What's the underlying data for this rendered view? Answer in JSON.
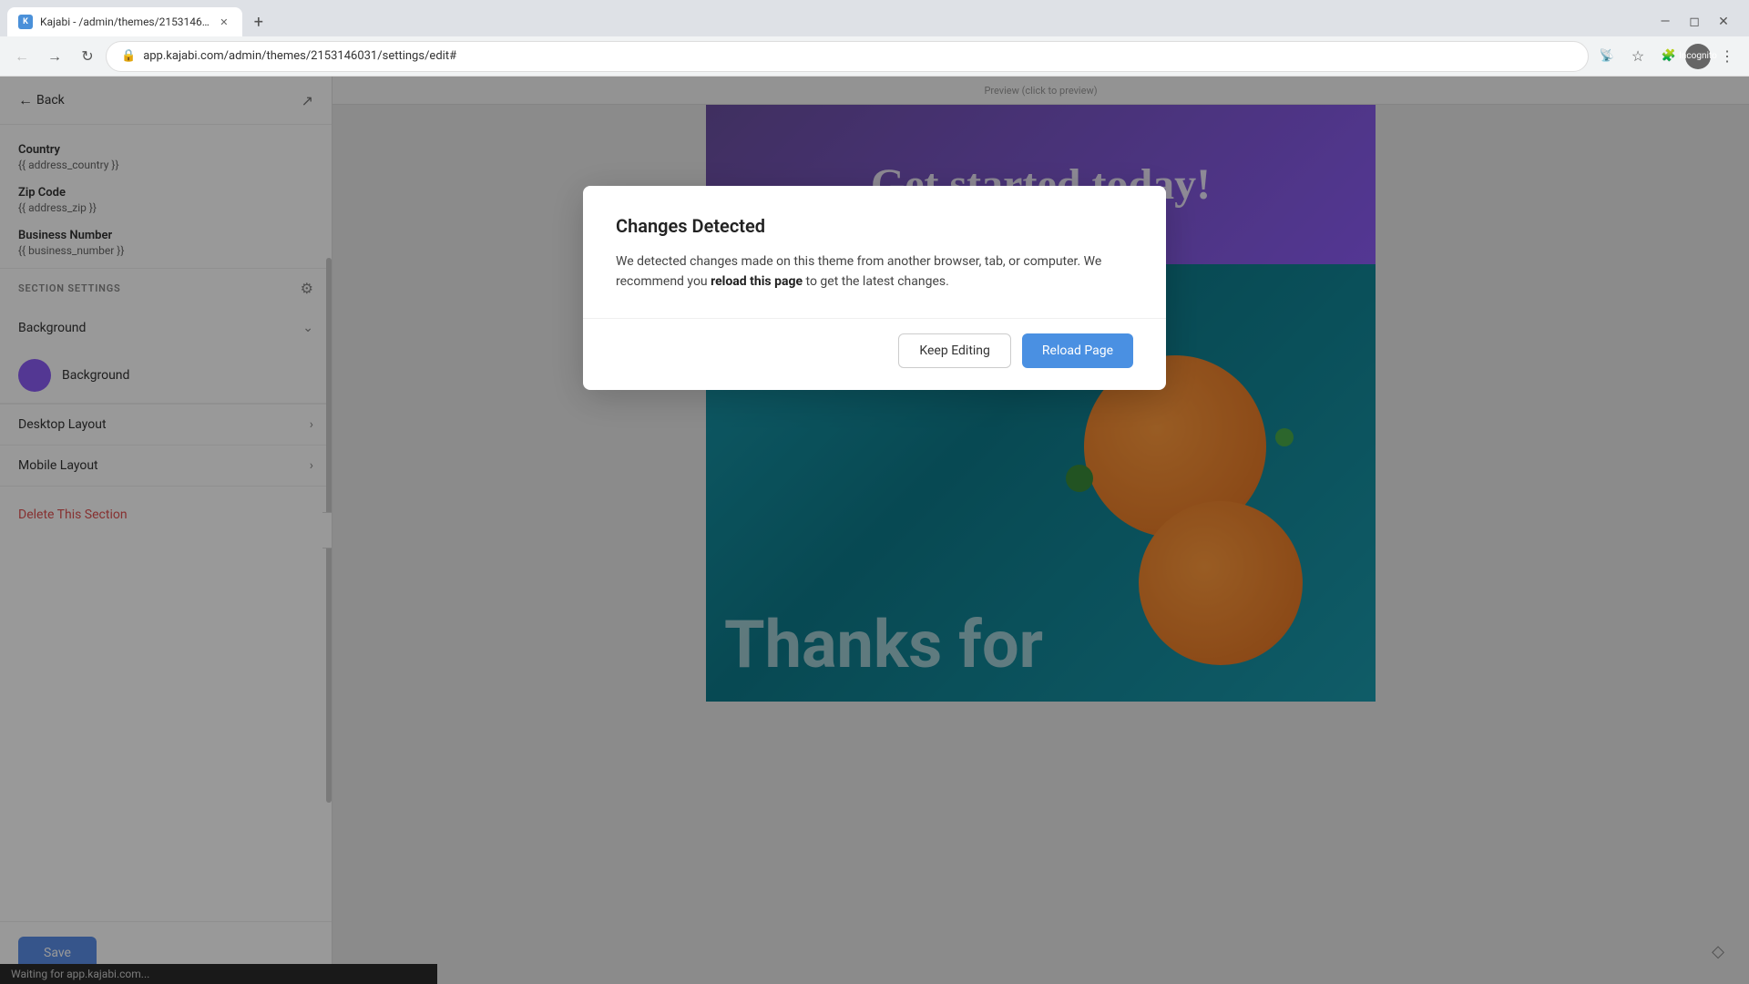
{
  "browser": {
    "tab_title": "Kajabi - /admin/themes/2153146…",
    "tab_favicon": "K",
    "address_url": "app.kajabi.com/admin/themes/2153146031/settings/edit#",
    "incognito_label": "Incognito"
  },
  "sidebar": {
    "back_label": "Back",
    "fields": [
      {
        "label": "Country",
        "value": "{{ address_country }}"
      },
      {
        "label": "Zip Code",
        "value": "{{ address_zip }}"
      },
      {
        "label": "Business Number",
        "value": "{{ business_number }}"
      }
    ],
    "section_settings_title": "SECTION SETTINGS",
    "background_accordion_label": "Background",
    "background_item_label": "Background",
    "background_color": "#8B5CF6",
    "desktop_layout_label": "Desktop Layout",
    "mobile_layout_label": "Mobile Layout",
    "delete_section_label": "Delete This Section",
    "save_label": "Save"
  },
  "preview": {
    "header_text": "Preview (click to preview)",
    "purple_text": "Get started today!",
    "bg_text": "Thanks for"
  },
  "modal": {
    "title": "Changes Detected",
    "body_text": "We detected changes made on this theme from another browser, tab, or computer. We recommend you ",
    "bold_text": "reload this page",
    "body_text_end": " to get the latest changes.",
    "keep_editing_label": "Keep Editing",
    "reload_label": "Reload Page"
  },
  "status_bar": {
    "text": "Waiting for app.kajabi.com..."
  }
}
